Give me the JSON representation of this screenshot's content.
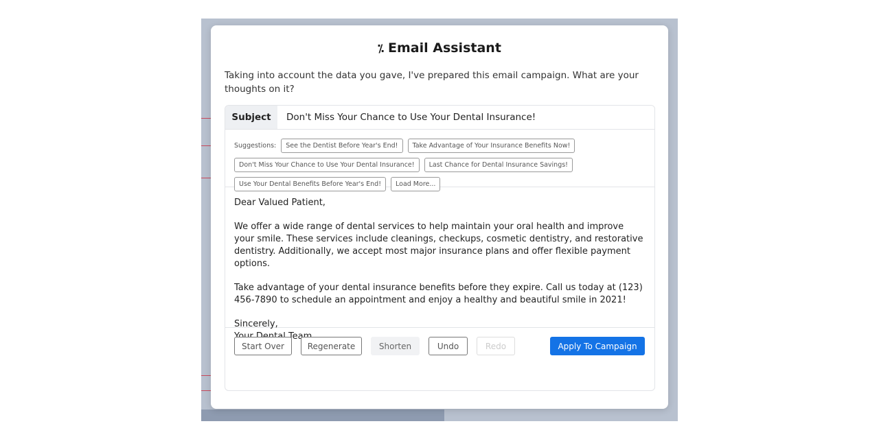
{
  "modal": {
    "title": "Email Assistant",
    "title_icon": "magic-wand-icon",
    "intro": "Taking into account the data you gave, I've prepared this email campaign. What are your thoughts on it?",
    "subject_label": "Subject",
    "subject_value": "Don't Miss Your Chance to Use Your Dental Insurance!",
    "suggestions_label": "Suggestions:",
    "suggestions": [
      "See the Dentist Before Year's End!",
      "Take Advantage of Your Insurance Benefits Now!",
      "Don't Miss Your Chance to Use Your Dental Insurance!",
      "Last Chance for Dental Insurance Savings!",
      "Use Your Dental Benefits Before Year's End!"
    ],
    "load_more": "Load More...",
    "body": {
      "greeting": "Dear Valued Patient,",
      "p1": "We offer a wide range of dental services to help maintain your oral health and improve your smile. These services include cleanings, checkups, cosmetic dentistry, and restorative dentistry. Additionally, we accept most major insurance plans and offer flexible payment options.",
      "p2": "Take advantage of your dental insurance benefits before they expire. Call us today at (123) 456-7890 to schedule an appointment and enjoy a healthy and beautiful smile in 2021!",
      "closing": "Sincerely,",
      "signature": "Your Dental Team"
    },
    "actions": {
      "start_over": "Start Over",
      "regenerate": "Regenerate",
      "shorten": "Shorten",
      "undo": "Undo",
      "redo": "Redo",
      "apply": "Apply To Campaign"
    }
  },
  "colors": {
    "primary": "#1473e6",
    "backdrop": "#b8c1cf"
  }
}
